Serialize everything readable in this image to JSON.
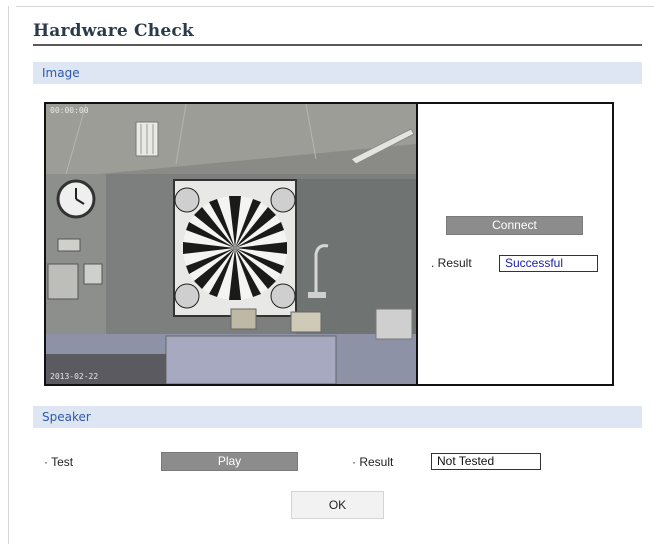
{
  "page": {
    "title": "Hardware Check"
  },
  "image_section": {
    "header": "Image",
    "camera_overlay_top": "00:00:00",
    "camera_overlay_bottom": "2013-02-22",
    "connect_button": "Connect",
    "result_label": ". Result",
    "result_value": "Successful",
    "result_color": "#1a1aa8"
  },
  "speaker_section": {
    "header": "Speaker",
    "test_label": "· Test",
    "play_button": "Play",
    "result_label": "· Result",
    "result_value": "Not Tested"
  },
  "ok_button": "OK"
}
